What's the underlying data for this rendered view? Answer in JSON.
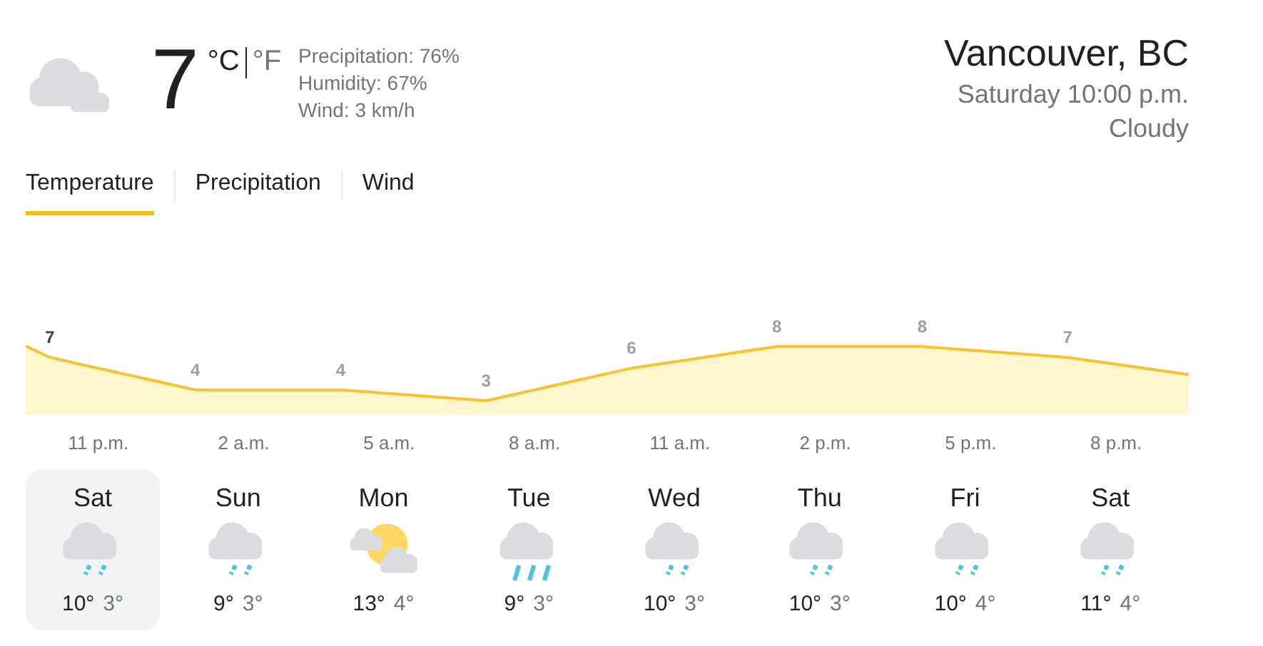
{
  "current": {
    "temperature": "7",
    "units": [
      {
        "label": "°C",
        "selected": true
      },
      {
        "label": "°F",
        "selected": false
      }
    ],
    "details": [
      "Precipitation: 76%",
      "Humidity: 67%",
      "Wind: 3 km/h"
    ]
  },
  "location": {
    "name": "Vancouver, BC",
    "time": "Saturday 10:00 p.m.",
    "condition": "Cloudy"
  },
  "tabs": [
    {
      "label": "Temperature",
      "selected": true
    },
    {
      "label": "Precipitation",
      "selected": false
    },
    {
      "label": "Wind",
      "selected": false
    }
  ],
  "chart": {
    "value_labels": [
      "7",
      "4",
      "4",
      "3",
      "6",
      "8",
      "8",
      "7"
    ],
    "time_labels": [
      "11 p.m.",
      "2 a.m.",
      "5 a.m.",
      "8 a.m.",
      "11 a.m.",
      "2 p.m.",
      "5 p.m.",
      "8 p.m."
    ]
  },
  "days": [
    {
      "day": "Sat",
      "kind": "light-rain",
      "high": "10°",
      "low": "3°",
      "selected": true
    },
    {
      "day": "Sun",
      "kind": "light-rain",
      "high": "9°",
      "low": "3°",
      "selected": false
    },
    {
      "day": "Mon",
      "kind": "partly-sunny",
      "high": "13°",
      "low": "4°",
      "selected": false
    },
    {
      "day": "Tue",
      "kind": "rain",
      "high": "9°",
      "low": "3°",
      "selected": false
    },
    {
      "day": "Wed",
      "kind": "light-rain",
      "high": "10°",
      "low": "3°",
      "selected": false
    },
    {
      "day": "Thu",
      "kind": "light-rain",
      "high": "10°",
      "low": "3°",
      "selected": false
    },
    {
      "day": "Fri",
      "kind": "light-rain",
      "high": "10°",
      "low": "4°",
      "selected": false
    },
    {
      "day": "Sat",
      "kind": "light-rain",
      "high": "11°",
      "low": "4°",
      "selected": false
    }
  ]
}
